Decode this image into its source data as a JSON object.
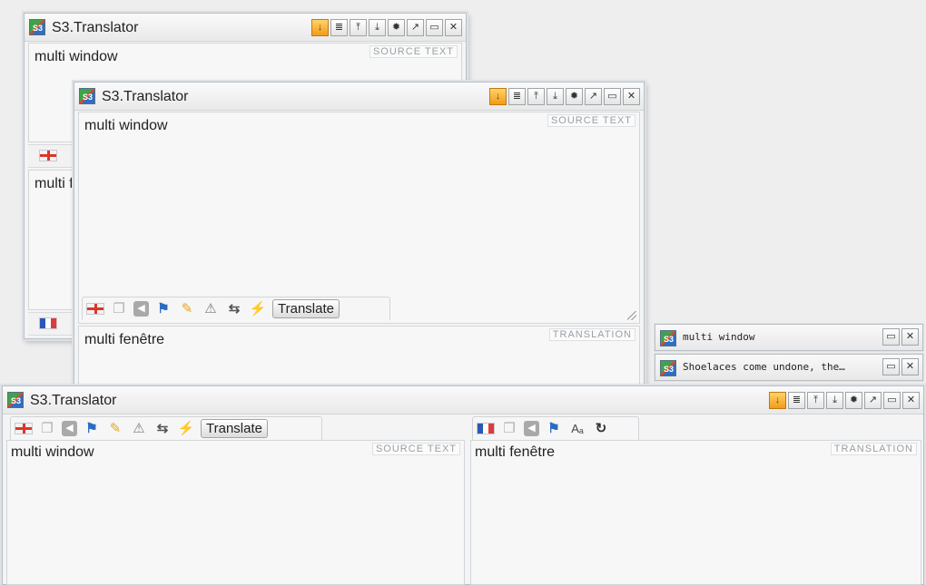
{
  "app": {
    "title": "S3.Translator"
  },
  "title_buttons": [
    "pin-icon",
    "page-icon",
    "dock-top-icon",
    "dock-bottom-icon",
    "settings-icon",
    "popout-icon",
    "minimize-icon",
    "close-icon"
  ],
  "labels": {
    "source": "SOURCE TEXT",
    "translation": "TRANSLATION",
    "translate_button": "Translate"
  },
  "source_text": "multi window",
  "translation_text": "multi fenêtre",
  "back_window": {
    "translation_partial": "multi f"
  },
  "mini_windows": [
    {
      "text": "multi window"
    },
    {
      "text": "Shoelaces come undone, the…"
    }
  ],
  "colors": {
    "pin": "#f19b1a",
    "border": "#b9bfc5"
  }
}
